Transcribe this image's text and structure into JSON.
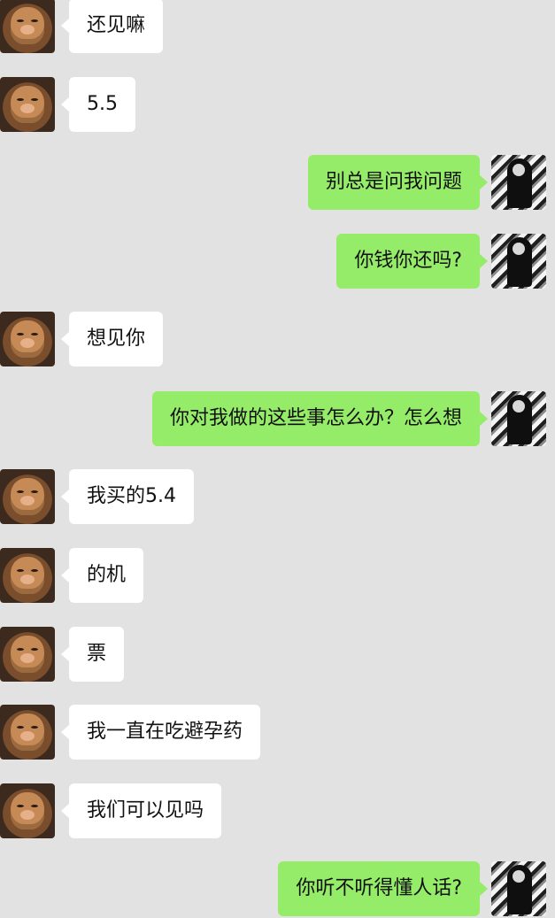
{
  "conversation": {
    "messages": [
      {
        "side": "in",
        "text": "还见嘛"
      },
      {
        "side": "in",
        "text": "5.5"
      },
      {
        "side": "out",
        "text": "别总是问我问题"
      },
      {
        "side": "out",
        "text": "你钱你还吗?"
      },
      {
        "side": "in",
        "text": "想见你"
      },
      {
        "side": "out",
        "text": "你对我做的这些事怎么办？怎么想"
      },
      {
        "side": "in",
        "text": "我买的5.4"
      },
      {
        "side": "in",
        "text": "的机"
      },
      {
        "side": "in",
        "text": "票"
      },
      {
        "side": "in",
        "text": "我一直在吃避孕药"
      },
      {
        "side": "in",
        "text": "我们可以见吗"
      },
      {
        "side": "out",
        "text": "你听不听得懂人话?"
      }
    ]
  },
  "colors": {
    "background": "#e2e2e2",
    "incoming_bubble": "#ffffff",
    "outgoing_bubble": "#95ec69",
    "text": "#111111"
  },
  "icons": {
    "incoming_avatar": "pig-avatar-icon",
    "outgoing_avatar": "manga-avatar-icon"
  }
}
